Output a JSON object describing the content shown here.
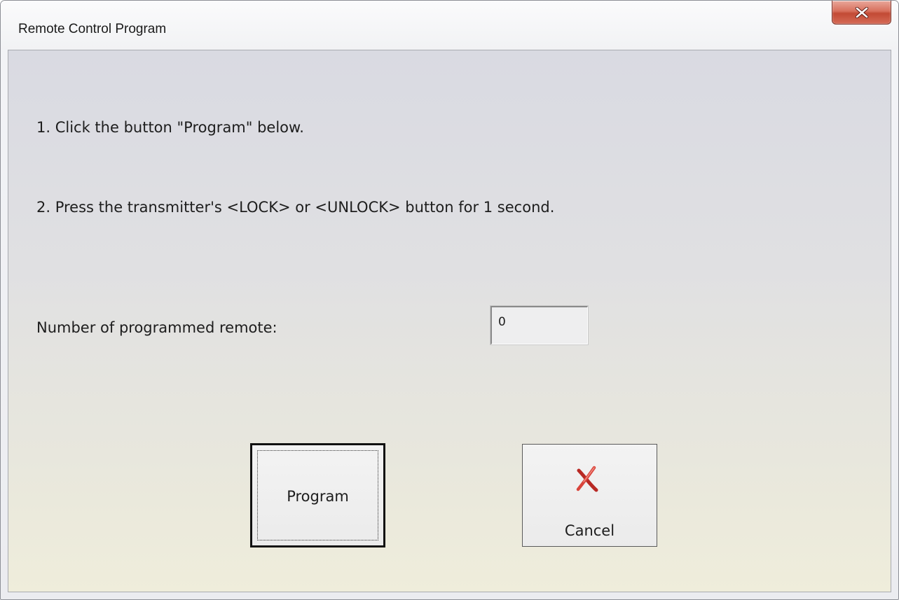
{
  "window": {
    "title": "Remote Control Program"
  },
  "instructions": {
    "step1": "1. Click the button \"Program\" below.",
    "step2": "2. Press the transmitter's <LOCK> or <UNLOCK> button for 1 second."
  },
  "count": {
    "label": "Number of programmed remote:",
    "value": "0"
  },
  "buttons": {
    "program": "Program",
    "cancel": "Cancel"
  },
  "icons": {
    "close": "close-icon",
    "cancel": "red-x-icon"
  },
  "colors": {
    "close_button": "#c94a36",
    "cancel_icon": "#d23a34"
  }
}
